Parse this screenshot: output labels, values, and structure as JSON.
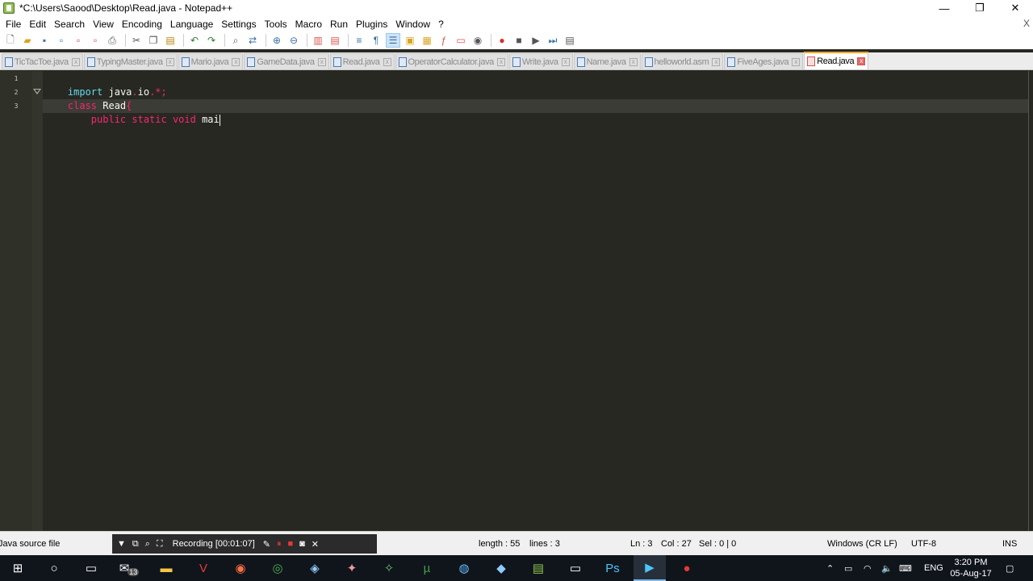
{
  "window": {
    "title": "*C:\\Users\\Saood\\Desktop\\Read.java - Notepad++",
    "minimize_glyph": "—",
    "restore_glyph": "❐",
    "close_glyph": "✕"
  },
  "menu": {
    "items": [
      "File",
      "Edit",
      "Search",
      "View",
      "Encoding",
      "Language",
      "Settings",
      "Tools",
      "Macro",
      "Run",
      "Plugins",
      "Window",
      "?"
    ],
    "close_glyph": "X"
  },
  "tabs": [
    {
      "label": "TicTacToe.java",
      "active": false
    },
    {
      "label": "TypingMaster.java",
      "active": false
    },
    {
      "label": "Mario.java",
      "active": false
    },
    {
      "label": "GameData.java",
      "active": false
    },
    {
      "label": "Read.java",
      "active": false
    },
    {
      "label": "OperatorCalculator.java",
      "active": false
    },
    {
      "label": "Write.java",
      "active": false
    },
    {
      "label": "Name.java",
      "active": false
    },
    {
      "label": "helloworld.asm",
      "active": false
    },
    {
      "label": "FiveAges.java",
      "active": false
    },
    {
      "label": "Read.java",
      "active": true
    }
  ],
  "editor": {
    "line_numbers": [
      "1",
      "2",
      "3"
    ],
    "lines": [
      {
        "segments": [
          {
            "text": "import",
            "color": "#66d9ef"
          },
          {
            "text": " java",
            "color": "#f8f8f2"
          },
          {
            "text": ".",
            "color": "#f92672"
          },
          {
            "text": "io",
            "color": "#f8f8f2"
          },
          {
            "text": ".*;",
            "color": "#f92672"
          }
        ]
      },
      {
        "segments": [
          {
            "text": "class",
            "color": "#f92672"
          },
          {
            "text": " Read",
            "color": "#f8f8f2"
          },
          {
            "text": "{",
            "color": "#f92672"
          }
        ]
      },
      {
        "segments": [
          {
            "text": "    public static void",
            "color": "#f92672"
          },
          {
            "text": " mai",
            "color": "#f8f8f2"
          }
        ]
      }
    ]
  },
  "statusbar": {
    "file_type": "Java source file",
    "recording_label": "Recording [00:01:07]",
    "length": "length : 55",
    "lines": "lines : 3",
    "ln": "Ln : 3",
    "col": "Col : 27",
    "sel": "Sel : 0 | 0",
    "eol": "Windows (CR LF)",
    "encoding": "UTF-8",
    "mode": "INS"
  },
  "taskbar": {
    "mail_badge": "13",
    "lang": "ENG",
    "time": "3:20 PM",
    "date": "05-Aug-17"
  },
  "colors": {
    "editor_bg": "#272822",
    "keyword": "#66d9ef",
    "operator": "#f92672",
    "text": "#f8f8f2",
    "active_tab_accent": "#f5a623"
  }
}
